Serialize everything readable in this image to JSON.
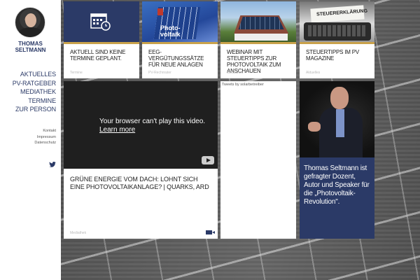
{
  "sidebar": {
    "name_line1": "THOMAS",
    "name_line2": "SELTMANN",
    "nav": [
      "AKTUELLES",
      "PV-RATGEBER",
      "MEDIATHEK",
      "TERMINE",
      "ZUR PERSON"
    ],
    "subnav": [
      "Kontakt",
      "Impressum",
      "Datenschutz"
    ]
  },
  "tiles": [
    {
      "title": "AKTUELL SIND KEINE TERMINE GEPLANT.",
      "category": "Termine",
      "image": "calendar-icon"
    },
    {
      "title": "EEG-VERGÜTUNGSSÄTZE FÜR NEUE ANLAGEN",
      "category": "PV-Rechnrater",
      "image_text": "Photo-voltaik"
    },
    {
      "title": "WEBINAR MIT STEUERTIPPS ZUR PHOTOVOLTAIK ZUM ANSCHAUEN",
      "category": "Mediathek"
    },
    {
      "title": "STEUERTIPPS IM PV MAGAZINE",
      "category": "Aktuelles",
      "image_text": "STEUERERKLÄRUNG"
    }
  ],
  "video": {
    "message": "Your browser can't play this video.",
    "link": "Learn more",
    "title": "GRÜNE ENERGIE VOM DACH: LOHNT SICH EINE PHOTOVOLTAIKANLAGE? | QUARKS, ARD",
    "category": "Mediathek"
  },
  "tweets": {
    "label": "Tweets by solarbetreiber"
  },
  "profile": {
    "text": "Thomas Seltmann ist gefragter Dozent, Autor und Speaker für die „Photovoltaik-Revolution\"."
  },
  "colors": {
    "brand": "#2b3a67",
    "accent": "#c9a24b"
  }
}
